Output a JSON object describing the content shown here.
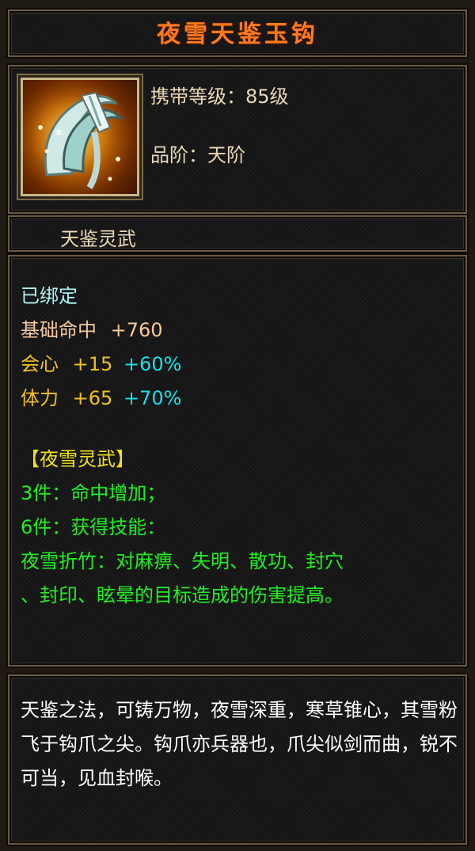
{
  "item": {
    "name": "夜雪天鉴玉钩",
    "carry_level": "携带等级：85级",
    "grade": "品阶：天阶",
    "category": "天鉴灵武"
  },
  "stats": {
    "bound": "已绑定",
    "base_hit_label": "基础命中",
    "base_hit_value": "+760",
    "crit_label": "会心",
    "crit_value": "+15",
    "crit_pct": "+60%",
    "stamina_label": "体力",
    "stamina_value": "+65",
    "stamina_pct": "+70%"
  },
  "set": {
    "name": "【夜雪灵武】",
    "bonus_3": "3件：命中增加；",
    "bonus_6": "6件：获得技能：",
    "skill_line1": "夜雪折竹：对麻痹、失明、散功、封穴",
    "skill_line2": "、封印、眩晕的目标造成的伤害提高。"
  },
  "lore": "天鉴之法，可铸万物，夜雪深重，寒草锥心，其雪粉飞于钩爪之尖。钩爪亦兵器也，爪尖似剑而曲，锐不可当，见血封喉。",
  "colors": {
    "title": "#ff7a1e",
    "bound": "#aef2f2",
    "base_stat": "#f5c9a0",
    "stat_yellow": "#f0c020",
    "stat_cyan": "#19e0e8",
    "set_green": "#22ee22",
    "set_name": "#f0e020"
  },
  "icon": "claw-weapon-icon"
}
